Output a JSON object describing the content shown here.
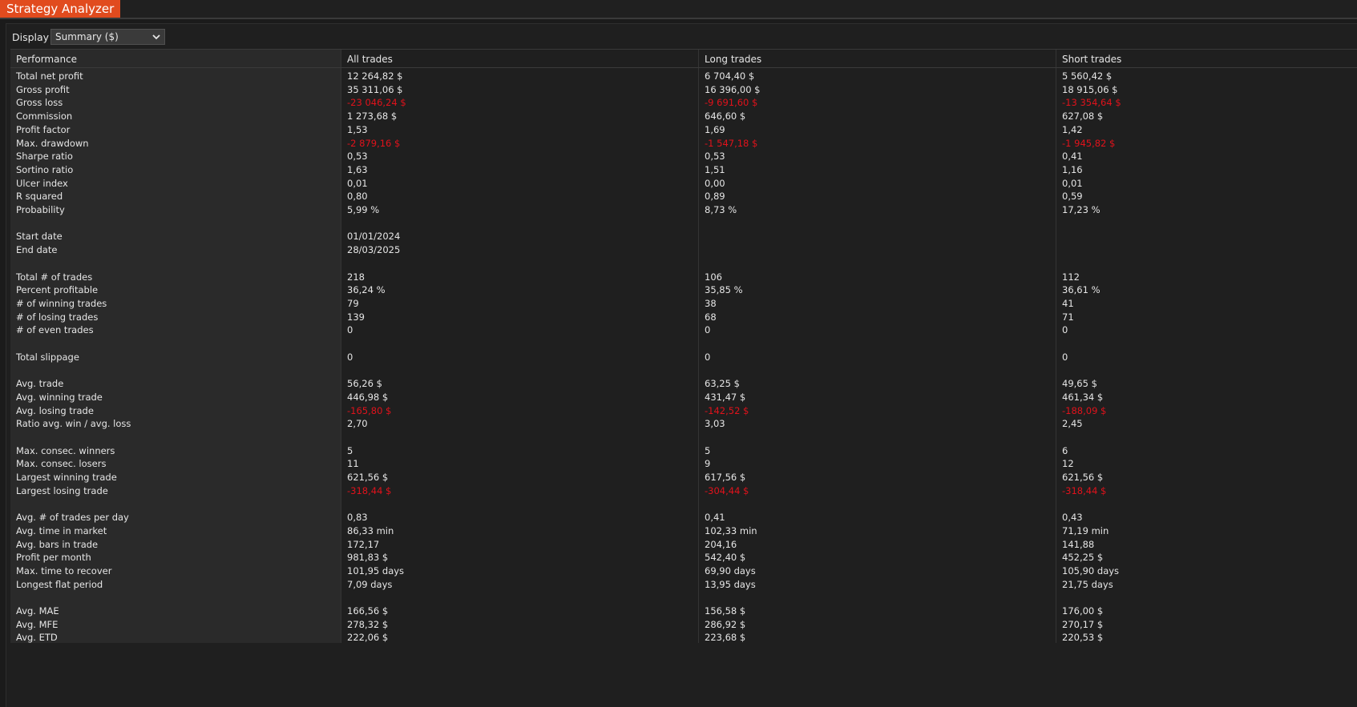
{
  "window": {
    "title": "Strategy Analyzer"
  },
  "display": {
    "label": "Display",
    "selected": "Summary ($)"
  },
  "columns": [
    "Performance",
    "All trades",
    "Long trades",
    "Short trades"
  ],
  "rows": [
    {
      "label": "Total net profit",
      "all": "12 264,82 $",
      "long": "6 704,40 $",
      "short": "5 560,42 $"
    },
    {
      "label": "Gross profit",
      "all": "35 311,06 $",
      "long": "16 396,00 $",
      "short": "18 915,06 $"
    },
    {
      "label": "Gross loss",
      "all": "-23 046,24 $",
      "long": "-9 691,60 $",
      "short": "-13 354,64 $",
      "negative": true
    },
    {
      "label": "Commission",
      "all": "1 273,68 $",
      "long": "646,60 $",
      "short": "627,08 $"
    },
    {
      "label": "Profit factor",
      "all": "1,53",
      "long": "1,69",
      "short": "1,42"
    },
    {
      "label": "Max. drawdown",
      "all": "-2 879,16 $",
      "long": "-1 547,18 $",
      "short": "-1 945,82 $",
      "negative": true
    },
    {
      "label": "Sharpe ratio",
      "all": "0,53",
      "long": "0,53",
      "short": "0,41"
    },
    {
      "label": "Sortino ratio",
      "all": "1,63",
      "long": "1,51",
      "short": "1,16"
    },
    {
      "label": "Ulcer index",
      "all": "0,01",
      "long": "0,00",
      "short": "0,01"
    },
    {
      "label": "R squared",
      "all": "0,80",
      "long": "0,89",
      "short": "0,59"
    },
    {
      "label": "Probability",
      "all": "5,99 %",
      "long": "8,73 %",
      "short": "17,23 %"
    },
    {
      "label": "",
      "all": "",
      "long": "",
      "short": ""
    },
    {
      "label": "Start date",
      "all": "01/01/2024",
      "long": "",
      "short": ""
    },
    {
      "label": "End date",
      "all": "28/03/2025",
      "long": "",
      "short": ""
    },
    {
      "label": "",
      "all": "",
      "long": "",
      "short": ""
    },
    {
      "label": "Total # of trades",
      "all": "218",
      "long": "106",
      "short": "112"
    },
    {
      "label": "Percent profitable",
      "all": "36,24 %",
      "long": "35,85 %",
      "short": "36,61 %"
    },
    {
      "label": "# of winning trades",
      "all": "79",
      "long": "38",
      "short": "41"
    },
    {
      "label": "# of losing trades",
      "all": "139",
      "long": "68",
      "short": "71"
    },
    {
      "label": "# of even trades",
      "all": "0",
      "long": "0",
      "short": "0"
    },
    {
      "label": "",
      "all": "",
      "long": "",
      "short": ""
    },
    {
      "label": "Total slippage",
      "all": "0",
      "long": "0",
      "short": "0"
    },
    {
      "label": "",
      "all": "",
      "long": "",
      "short": ""
    },
    {
      "label": "Avg. trade",
      "all": "56,26 $",
      "long": "63,25 $",
      "short": "49,65 $"
    },
    {
      "label": "Avg. winning trade",
      "all": "446,98 $",
      "long": "431,47 $",
      "short": "461,34 $"
    },
    {
      "label": "Avg. losing trade",
      "all": "-165,80 $",
      "long": "-142,52 $",
      "short": "-188,09 $",
      "negative": true
    },
    {
      "label": "Ratio avg. win / avg. loss",
      "all": "2,70",
      "long": "3,03",
      "short": "2,45"
    },
    {
      "label": "",
      "all": "",
      "long": "",
      "short": ""
    },
    {
      "label": "Max. consec. winners",
      "all": "5",
      "long": "5",
      "short": "6"
    },
    {
      "label": "Max. consec. losers",
      "all": "11",
      "long": "9",
      "short": "12"
    },
    {
      "label": "Largest winning trade",
      "all": "621,56 $",
      "long": "617,56 $",
      "short": "621,56 $"
    },
    {
      "label": "Largest losing trade",
      "all": "-318,44 $",
      "long": "-304,44 $",
      "short": "-318,44 $",
      "negative": true
    },
    {
      "label": "",
      "all": "",
      "long": "",
      "short": ""
    },
    {
      "label": "Avg. # of trades per day",
      "all": "0,83",
      "long": "0,41",
      "short": "0,43"
    },
    {
      "label": "Avg. time in market",
      "all": "86,33 min",
      "long": "102,33 min",
      "short": "71,19 min"
    },
    {
      "label": "Avg. bars in trade",
      "all": "172,17",
      "long": "204,16",
      "short": "141,88"
    },
    {
      "label": "Profit per month",
      "all": "981,83 $",
      "long": "542,40 $",
      "short": "452,25 $"
    },
    {
      "label": "Max. time to recover",
      "all": "101,95 days",
      "long": "69,90 days",
      "short": "105,90 days"
    },
    {
      "label": "Longest flat period",
      "all": "7,09 days",
      "long": "13,95 days",
      "short": "21,75 days"
    },
    {
      "label": "",
      "all": "",
      "long": "",
      "short": ""
    },
    {
      "label": "Avg. MAE",
      "all": "166,56 $",
      "long": "156,58 $",
      "short": "176,00 $"
    },
    {
      "label": "Avg. MFE",
      "all": "278,32 $",
      "long": "286,92 $",
      "short": "270,17 $"
    },
    {
      "label": "Avg. ETD",
      "all": "222,06 $",
      "long": "223,68 $",
      "short": "220,53 $"
    }
  ],
  "colors": {
    "accent": "#e14b1e",
    "negative": "#e0121b",
    "background": "#1b1b1b",
    "label_column": "#2a2a2a"
  }
}
